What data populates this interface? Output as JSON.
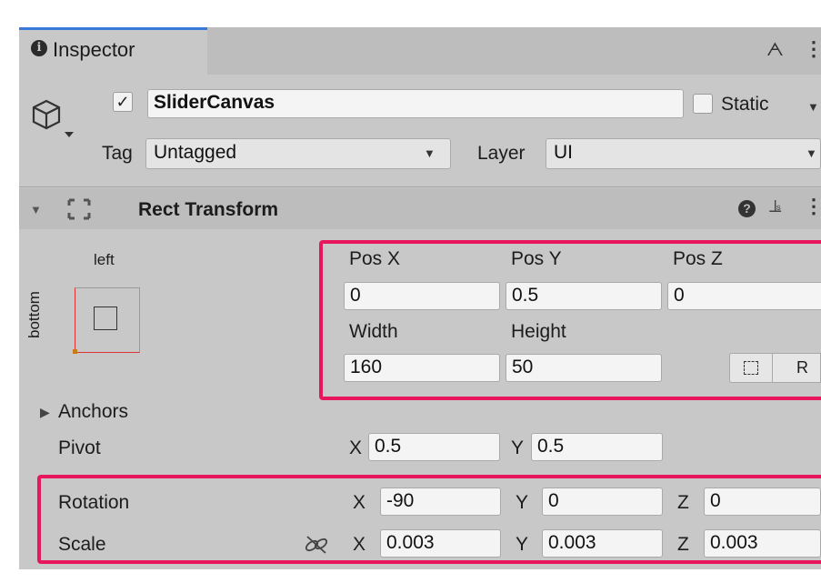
{
  "inspector_tab": {
    "label": "Inspector"
  },
  "gameobject": {
    "name": "SliderCanvas",
    "active_check": "✓",
    "static_label": "Static",
    "tag_label": "Tag",
    "tag_value": "Untagged",
    "layer_label": "Layer",
    "layer_value": "UI"
  },
  "rect_transform": {
    "title": "Rect Transform",
    "anchor_preset": {
      "h_label": "left",
      "v_label": "bottom"
    },
    "pos_x_label": "Pos X",
    "pos_x": "0",
    "pos_y_label": "Pos Y",
    "pos_y": "0.5",
    "pos_z_label": "Pos Z",
    "pos_z": "0",
    "width_label": "Width",
    "width": "160",
    "height_label": "Height",
    "height": "50",
    "raw_edit_label": "R",
    "anchors_label": "Anchors",
    "pivot_label": "Pivot",
    "pivot_x_label": "X",
    "pivot_x": "0.5",
    "pivot_y_label": "Y",
    "pivot_y": "0.5",
    "rotation_label": "Rotation",
    "rot_x_label": "X",
    "rot_x": "-90",
    "rot_y_label": "Y",
    "rot_y": "0",
    "rot_z_label": "Z",
    "rot_z": "0",
    "scale_label": "Scale",
    "scale_x_label": "X",
    "scale_x": "0.003",
    "scale_y_label": "Y",
    "scale_y": "0.003",
    "scale_z_label": "Z",
    "scale_z": "0.003"
  },
  "colors": {
    "highlight": "#e8175d",
    "panel": "#c8c8c8",
    "tab_accent": "#3a79d8"
  },
  "icons": [
    "info-icon",
    "lock-icon",
    "kebab-icon",
    "gameobject-cube-icon",
    "chevron-down-icon",
    "foldout-icon",
    "rect-transform-icon",
    "help-icon",
    "preset-icon",
    "blueprint-icon",
    "link-scale-icon"
  ]
}
